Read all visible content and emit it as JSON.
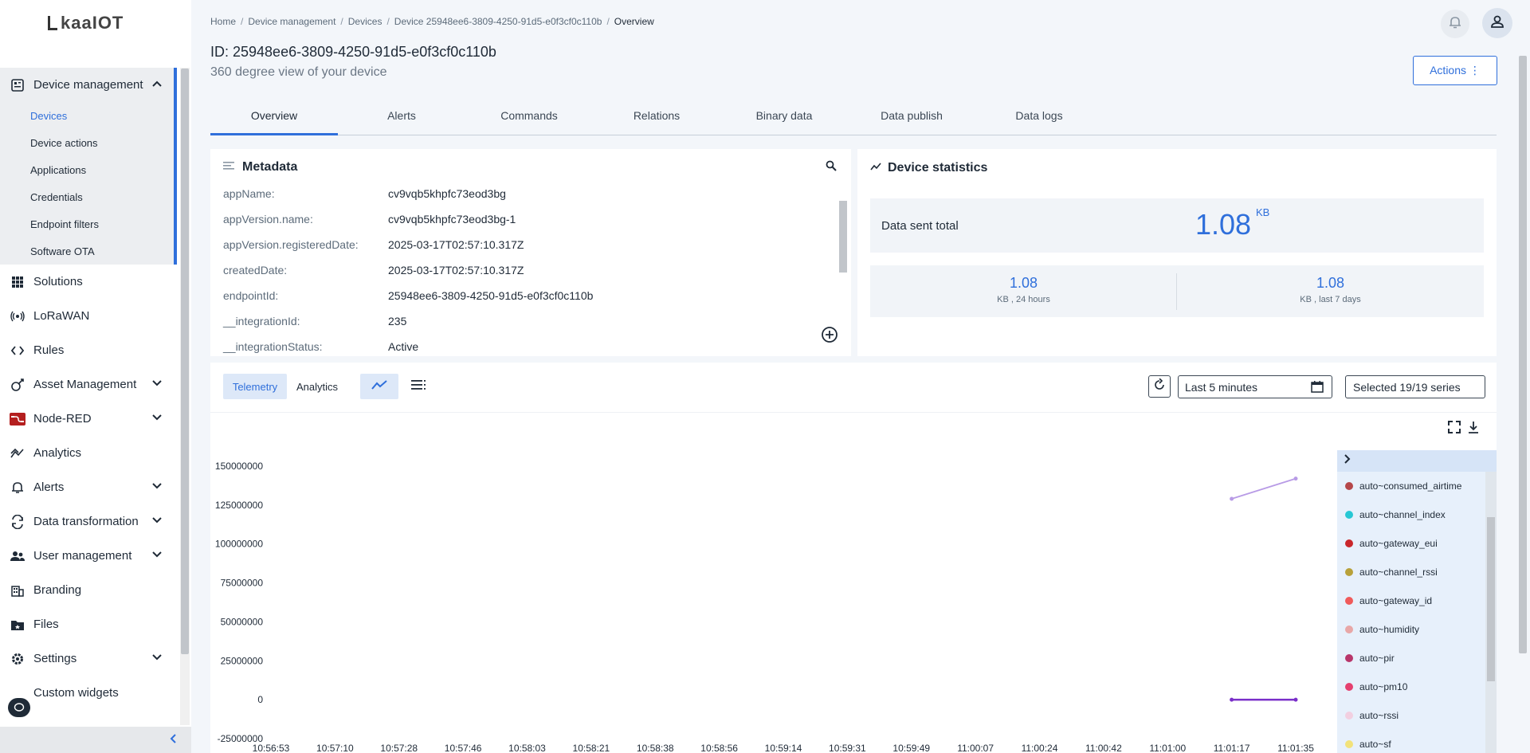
{
  "logo": "kaaIOT",
  "sidebar": {
    "groups": [
      {
        "label": "Device management",
        "icon": "device-management-icon",
        "expanded": true,
        "children": [
          "Devices",
          "Device actions",
          "Applications",
          "Credentials",
          "Endpoint filters",
          "Software OTA"
        ],
        "active_child": "Devices"
      }
    ],
    "items": [
      {
        "label": "Solutions",
        "icon": "grid-icon",
        "chevron": false
      },
      {
        "label": "LoRaWAN",
        "icon": "lorawan-icon",
        "chevron": false
      },
      {
        "label": "Rules",
        "icon": "code-icon",
        "chevron": false
      },
      {
        "label": "Asset Management",
        "icon": "asset-icon",
        "chevron": true
      },
      {
        "label": "Node-RED",
        "icon": "node-red-icon",
        "chevron": true
      },
      {
        "label": "Analytics",
        "icon": "analytics-icon",
        "chevron": false
      },
      {
        "label": "Alerts",
        "icon": "bell-icon",
        "chevron": true
      },
      {
        "label": "Data transformation",
        "icon": "transform-icon",
        "chevron": true
      },
      {
        "label": "User management",
        "icon": "users-icon",
        "chevron": true
      },
      {
        "label": "Branding",
        "icon": "branding-icon",
        "chevron": false
      },
      {
        "label": "Files",
        "icon": "folder-icon",
        "chevron": false
      },
      {
        "label": "Settings",
        "icon": "gear-icon",
        "chevron": true
      },
      {
        "label": "Custom widgets",
        "icon": "widgets-icon",
        "chevron": false
      }
    ],
    "collapse_icon": "chevron-left-icon"
  },
  "breadcrumb": [
    "Home",
    "Device management",
    "Devices",
    "Device 25948ee6-3809-4250-91d5-e0f3cf0c110b",
    "Overview"
  ],
  "header": {
    "title": "ID: 25948ee6-3809-4250-91d5-e0f3cf0c110b",
    "subtitle": "360 degree view of your device",
    "actions_label": "Actions ⋮"
  },
  "tabs": [
    "Overview",
    "Alerts",
    "Commands",
    "Relations",
    "Binary data",
    "Data publish",
    "Data logs"
  ],
  "metadata": {
    "title": "Metadata",
    "rows": [
      {
        "key": "appName:",
        "value": "cv9vqb5khpfc73eod3bg"
      },
      {
        "key": "appVersion.name:",
        "value": "cv9vqb5khpfc73eod3bg-1"
      },
      {
        "key": "appVersion.registeredDate:",
        "value": "2025-03-17T02:57:10.317Z"
      },
      {
        "key": "createdDate:",
        "value": "2025-03-17T02:57:10.317Z"
      },
      {
        "key": "endpointId:",
        "value": "25948ee6-3809-4250-91d5-e0f3cf0c110b"
      },
      {
        "key": "__integrationId:",
        "value": "235"
      },
      {
        "key": "__integrationStatus:",
        "value": "Active"
      }
    ]
  },
  "stats": {
    "title": "Device statistics",
    "total_label": "Data sent total",
    "total_value": "1.08",
    "total_unit": "KB",
    "day_value": "1.08",
    "day_label": "KB , 24 hours",
    "week_value": "1.08",
    "week_label": "KB , last 7 days"
  },
  "chart_toolbar": {
    "telemetry_label": "Telemetry",
    "analytics_label": "Analytics",
    "time_range": "Last 5 minutes",
    "series_label": "Selected 19/19 series"
  },
  "colors": {
    "accent": "#2f6fdb",
    "series_upper": "#b89be6",
    "series_lower": "#7a2fc9"
  },
  "chart_data": {
    "type": "line",
    "y_ticks": [
      "150000000",
      "125000000",
      "100000000",
      "75000000",
      "50000000",
      "25000000",
      "0",
      "-25000000"
    ],
    "y_tick_values": [
      150000000,
      125000000,
      100000000,
      75000000,
      50000000,
      25000000,
      0,
      -25000000
    ],
    "x_ticks": [
      "10:56:53",
      "10:57:10",
      "10:57:28",
      "10:57:46",
      "10:58:03",
      "10:58:21",
      "10:58:38",
      "10:58:56",
      "10:59:14",
      "10:59:31",
      "10:59:49",
      "11:00:07",
      "11:00:24",
      "11:00:42",
      "11:01:00",
      "11:01:17",
      "11:01:35"
    ],
    "ylim": [
      -25000000,
      150000000
    ],
    "series": [
      {
        "points": [
          {
            "x": "11:01:17",
            "y": 129000000
          },
          {
            "x": "11:01:35",
            "y": 142000000
          }
        ],
        "color": "#b89be6"
      },
      {
        "points": [
          {
            "x": "11:01:17",
            "y": 0
          },
          {
            "x": "11:01:35",
            "y": 0
          }
        ],
        "color": "#7a2fc9"
      }
    ],
    "legend_position": "right",
    "legend": [
      {
        "name": "auto~consumed_airtime",
        "color": "#b5474a"
      },
      {
        "name": "auto~channel_index",
        "color": "#27c7d4"
      },
      {
        "name": "auto~gateway_eui",
        "color": "#c9262b"
      },
      {
        "name": "auto~channel_rssi",
        "color": "#b8a13a"
      },
      {
        "name": "auto~gateway_id",
        "color": "#f05a5a"
      },
      {
        "name": "auto~humidity",
        "color": "#e8a7a7"
      },
      {
        "name": "auto~pir",
        "color": "#b8366a"
      },
      {
        "name": "auto~pm10",
        "color": "#e5406f"
      },
      {
        "name": "auto~rssi",
        "color": "#f2cfe0"
      },
      {
        "name": "auto~sf",
        "color": "#f2e27a"
      }
    ]
  }
}
